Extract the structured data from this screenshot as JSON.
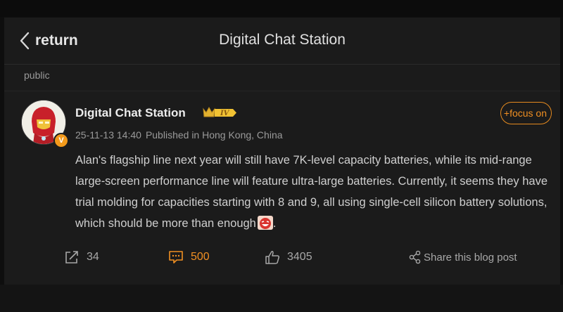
{
  "header": {
    "back_label": "return",
    "title": "Digital Chat Station"
  },
  "post": {
    "visibility": "public",
    "author": {
      "name": "Digital Chat Station",
      "level_badge": "IV",
      "verified_badge": "V"
    },
    "follow_label": "+focus on",
    "date": "25-11-13 14:40",
    "location": "Published in Hong Kong, China",
    "text": "Alan's flagship line next year will still have 7K-level capacity batteries, while its mid-range large-screen performance line will feature ultra-large batteries. Currently, it seems they have trial molding for capacities starting with 8 and 9, all using single-cell silicon battery solutions, which should be more than enough",
    "text_end": "."
  },
  "actions": {
    "reposts": "34",
    "comments": "500",
    "likes": "3405",
    "share_label": "Share this blog post"
  },
  "colors": {
    "accent": "#f08f22",
    "background": "#1b1b1b"
  },
  "icons": [
    "chevron-left-icon",
    "crown-level-icon",
    "repost-icon",
    "comment-icon",
    "thumbs-up-icon",
    "share-icon",
    "laughing-emoji-icon"
  ]
}
